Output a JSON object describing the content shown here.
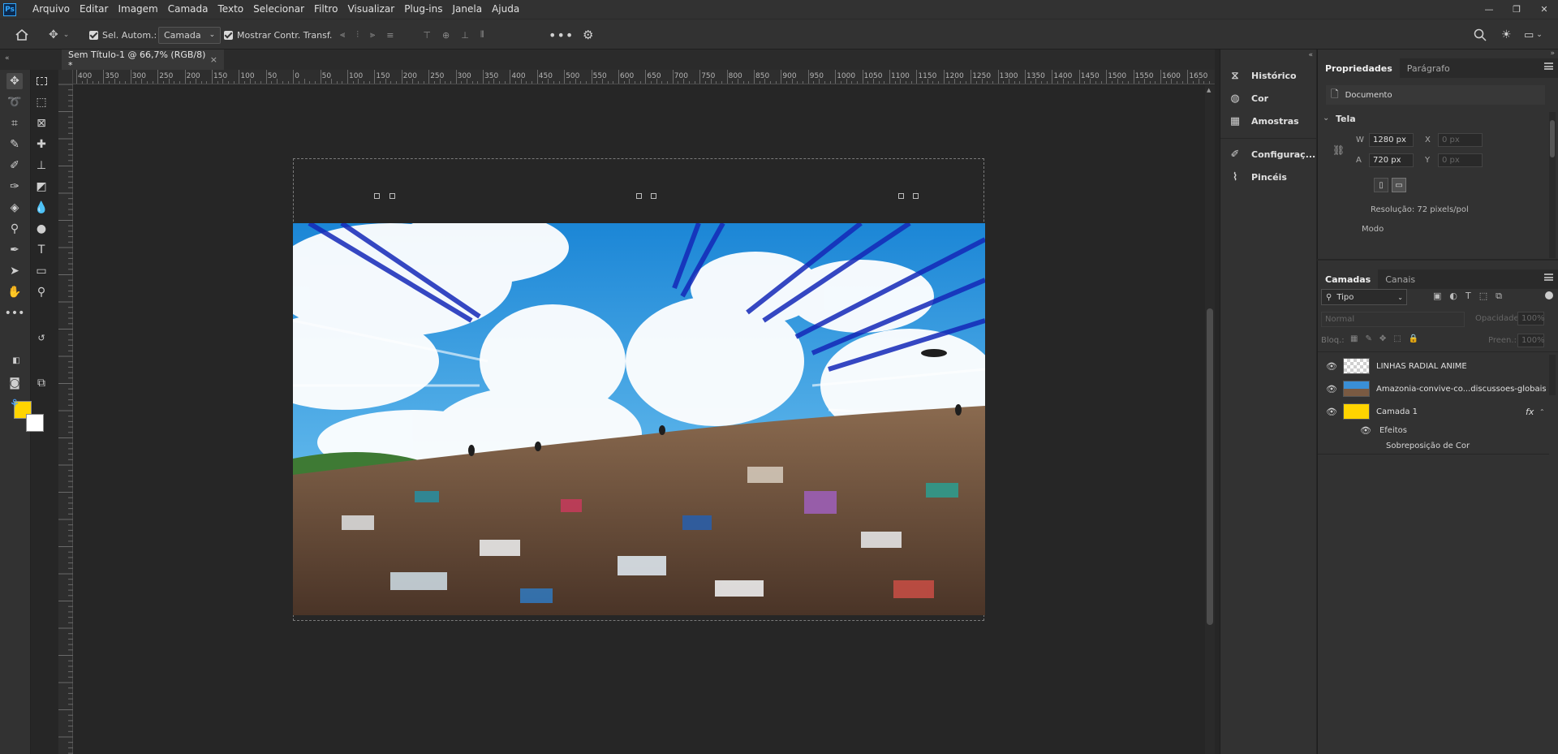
{
  "menubar": {
    "logo": "Ps",
    "items": [
      "Arquivo",
      "Editar",
      "Imagem",
      "Camada",
      "Texto",
      "Selecionar",
      "Filtro",
      "Visualizar",
      "Plug-ins",
      "Janela",
      "Ajuda"
    ]
  },
  "options": {
    "auto_select_label": "Sel. Autom.:",
    "auto_select_target": "Camada",
    "show_transform_label": "Mostrar Contr. Transf."
  },
  "document": {
    "tab_title": "Sem Título-1 @ 66,7% (RGB/8) *",
    "close_glyph": "×"
  },
  "ruler": {
    "h_ticks": [
      "400",
      "350",
      "300",
      "250",
      "200",
      "150",
      "100",
      "50",
      "0",
      "50",
      "100",
      "150",
      "200",
      "250",
      "300",
      "350",
      "400",
      "450",
      "500",
      "550",
      "600",
      "650",
      "700",
      "750",
      "800",
      "850",
      "900",
      "950",
      "1000",
      "1050",
      "1100",
      "1150",
      "1200",
      "1250",
      "1300",
      "1350",
      "1400",
      "1450",
      "1500",
      "1550",
      "1600",
      "1650"
    ]
  },
  "collapsed_panels": [
    {
      "label": "Histórico",
      "icon": "history-icon"
    },
    {
      "label": "Cor",
      "icon": "color-icon"
    },
    {
      "label": "Amostras",
      "icon": "swatches-icon"
    },
    {
      "label": "Configuraç...",
      "icon": "brush-settings-icon"
    },
    {
      "label": "Pincéis",
      "icon": "brushes-icon"
    }
  ],
  "properties": {
    "tabs": [
      "Propriedades",
      "Parágrafo"
    ],
    "doc_label": "Documento",
    "section": "Tela",
    "w_label": "W",
    "w_value": "1280 px",
    "h_label": "A",
    "h_value": "720 px",
    "x_label": "X",
    "x_value": "0 px",
    "y_label": "Y",
    "y_value": "0 px",
    "resolution": "Resolução: 72 pixels/pol",
    "mode": "Modo"
  },
  "layers": {
    "tabs": [
      "Camadas",
      "Canais"
    ],
    "filter": "Tipo",
    "blend_mode": "Normal",
    "opacity_label": "Opacidade:",
    "opacity_value": "100%",
    "lock_label": "Bloq.:",
    "fill_label": "Preen.:",
    "fill_value": "100%",
    "items": [
      {
        "name": "LINHAS RADIAL ANIME"
      },
      {
        "name": "Amazonia-convive-co...discussoes-globais"
      },
      {
        "name": "Camada 1",
        "fx": "fx"
      }
    ],
    "effects_label": "Efeitos",
    "effect_name": "Sobreposição de Cor"
  },
  "colors": {
    "foreground": "#ffd400",
    "background": "#ffffff"
  }
}
